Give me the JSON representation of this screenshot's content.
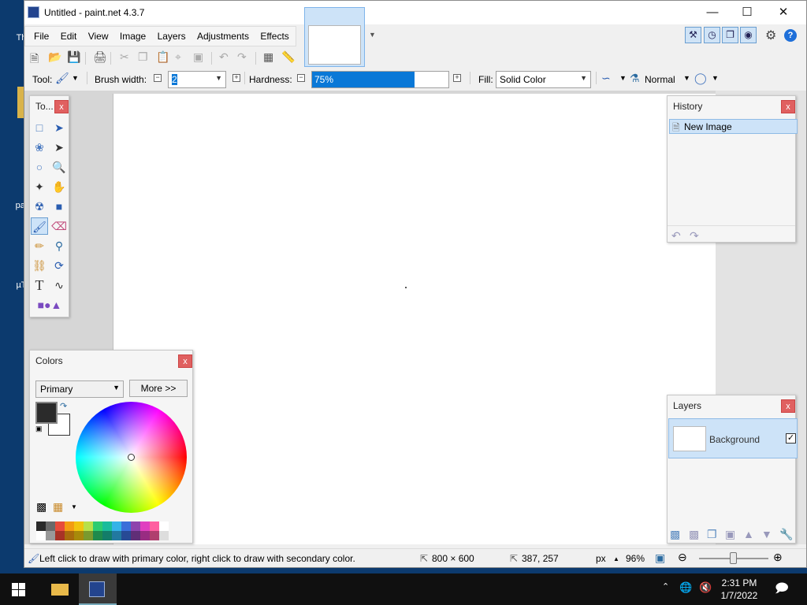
{
  "window": {
    "title": "Untitled - paint.net 4.3.7"
  },
  "desktop": {
    "icons": [
      "Th",
      "pai",
      "µT"
    ]
  },
  "menu": [
    "File",
    "Edit",
    "View",
    "Image",
    "Layers",
    "Adjustments",
    "Effects"
  ],
  "toolbar2": {
    "tool_label": "Tool:",
    "brush_width_label": "Brush width:",
    "brush_width_value": "2",
    "hardness_label": "Hardness:",
    "hardness_value": "75%",
    "hardness_fraction": 0.75,
    "fill_label": "Fill:",
    "fill_value": "Solid Color",
    "blend_value": "Normal"
  },
  "tools_panel": {
    "title": "To...",
    "close": "x",
    "selected": "paintbrush-tool"
  },
  "history_panel": {
    "title": "History",
    "close": "x",
    "items": [
      "New Image"
    ]
  },
  "colors_panel": {
    "title": "Colors",
    "close": "x",
    "mode": "Primary",
    "more_button": "More >>",
    "primary_color": "#2b2b2b",
    "secondary_color": "#ffffff"
  },
  "layers_panel": {
    "title": "Layers",
    "close": "x",
    "layers": [
      {
        "name": "Background",
        "visible": true
      }
    ]
  },
  "statusbar": {
    "hint": "Left click to draw with primary color, right click to draw with secondary color.",
    "image_size": "800 × 600",
    "cursor_pos": "387, 257",
    "unit": "px",
    "zoom": "96%"
  },
  "taskbar": {
    "time": "2:31 PM",
    "date": "1/7/2022"
  },
  "colors": {
    "accent": "#0a78d7",
    "selection": "#cde3f8",
    "close_red": "#e06060"
  }
}
